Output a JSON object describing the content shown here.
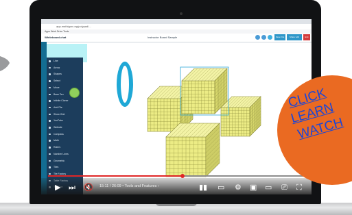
{
  "browser": {
    "url": "app.mathigon.org/polypad/...",
    "bookmarks": "Apps  Work  Drive  Tools"
  },
  "app": {
    "logo": "Whiteboard.chat",
    "doc_title": "Instructor Board Sample",
    "toolbar_buttons": [
      "Save File",
      "Share with Students",
      "Exit"
    ]
  },
  "sidebar": {
    "items": [
      {
        "label": "Line"
      },
      {
        "label": "Arrow"
      },
      {
        "label": "Shapes"
      },
      {
        "label": "Select"
      },
      {
        "label": "Move"
      },
      {
        "label": "Base Ten"
      },
      {
        "label": "Infinite Cloner"
      },
      {
        "label": "Add File"
      },
      {
        "label": "Show Grid"
      },
      {
        "label": "YouTube"
      },
      {
        "label": "Website"
      },
      {
        "label": "Compass"
      },
      {
        "label": "Math"
      },
      {
        "label": "Rulers"
      },
      {
        "label": "Number Lines"
      },
      {
        "label": "Geometric"
      },
      {
        "label": "Tiles"
      },
      {
        "label": "Tile Factory"
      },
      {
        "label": "Table Factory"
      },
      {
        "label": "Text Box"
      }
    ]
  },
  "video": {
    "time": "15:11 / 26:09",
    "chapter": "Tools and Features",
    "progress_fraction": 0.5
  },
  "badge": {
    "line1": "CLICK",
    "line2": "LEARN",
    "line3": "WATCH"
  },
  "colors": {
    "cube_fill": "#ecec85",
    "cube_grid": "#8a8a3a",
    "ring": "#1fa8d6",
    "sidebar": "#1c3d5c",
    "badge": "#ea6a22",
    "badge_text": "#1a46d8",
    "progress": "#e02626"
  }
}
